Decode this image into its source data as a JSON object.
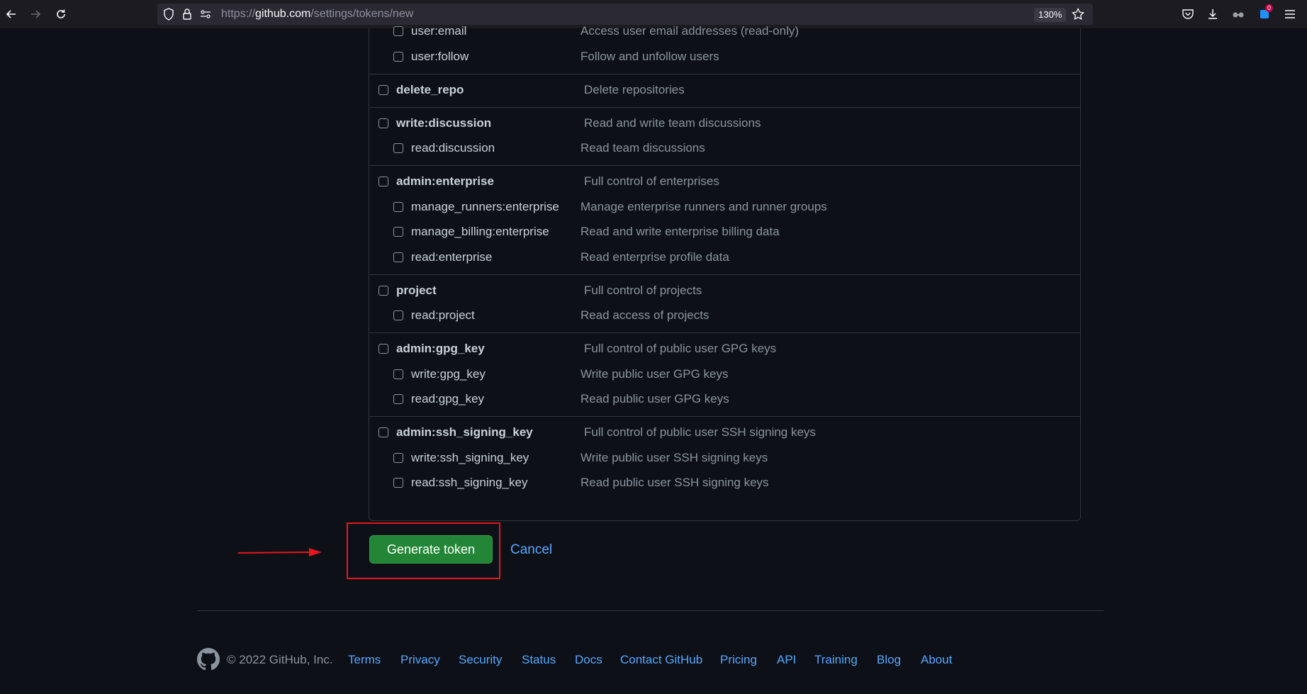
{
  "browser": {
    "url_prefix": "https://",
    "url_host": "github.com",
    "url_path": "/settings/tokens/new",
    "zoom": "130%",
    "ext_badge": "0"
  },
  "scopes": {
    "groups": [
      {
        "parent": null,
        "children": [
          {
            "name": "user:email",
            "desc": "Access user email addresses (read-only)"
          },
          {
            "name": "user:follow",
            "desc": "Follow and unfollow users"
          }
        ]
      },
      {
        "parent": {
          "name": "delete_repo",
          "desc": "Delete repositories"
        },
        "children": []
      },
      {
        "parent": {
          "name": "write:discussion",
          "desc": "Read and write team discussions"
        },
        "children": [
          {
            "name": "read:discussion",
            "desc": "Read team discussions"
          }
        ]
      },
      {
        "parent": {
          "name": "admin:enterprise",
          "desc": "Full control of enterprises"
        },
        "children": [
          {
            "name": "manage_runners:enterprise",
            "desc": "Manage enterprise runners and runner groups"
          },
          {
            "name": "manage_billing:enterprise",
            "desc": "Read and write enterprise billing data"
          },
          {
            "name": "read:enterprise",
            "desc": "Read enterprise profile data"
          }
        ]
      },
      {
        "parent": {
          "name": "project",
          "desc": "Full control of projects"
        },
        "children": [
          {
            "name": "read:project",
            "desc": "Read access of projects"
          }
        ]
      },
      {
        "parent": {
          "name": "admin:gpg_key",
          "desc": "Full control of public user GPG keys"
        },
        "children": [
          {
            "name": "write:gpg_key",
            "desc": "Write public user GPG keys"
          },
          {
            "name": "read:gpg_key",
            "desc": "Read public user GPG keys"
          }
        ]
      },
      {
        "parent": {
          "name": "admin:ssh_signing_key",
          "desc": "Full control of public user SSH signing keys"
        },
        "children": [
          {
            "name": "write:ssh_signing_key",
            "desc": "Write public user SSH signing keys"
          },
          {
            "name": "read:ssh_signing_key",
            "desc": "Read public user SSH signing keys"
          }
        ]
      }
    ]
  },
  "actions": {
    "generate_label": "Generate token",
    "cancel_label": "Cancel"
  },
  "footer": {
    "copyright": "© 2022 GitHub, Inc.",
    "links": [
      "Terms",
      "Privacy",
      "Security",
      "Status",
      "Docs",
      "Contact GitHub",
      "Pricing",
      "API",
      "Training",
      "Blog",
      "About"
    ]
  },
  "colors": {
    "background": "#0d1117",
    "primary_button": "#238636",
    "link": "#58a6ff",
    "annotation": "#e8141c"
  }
}
